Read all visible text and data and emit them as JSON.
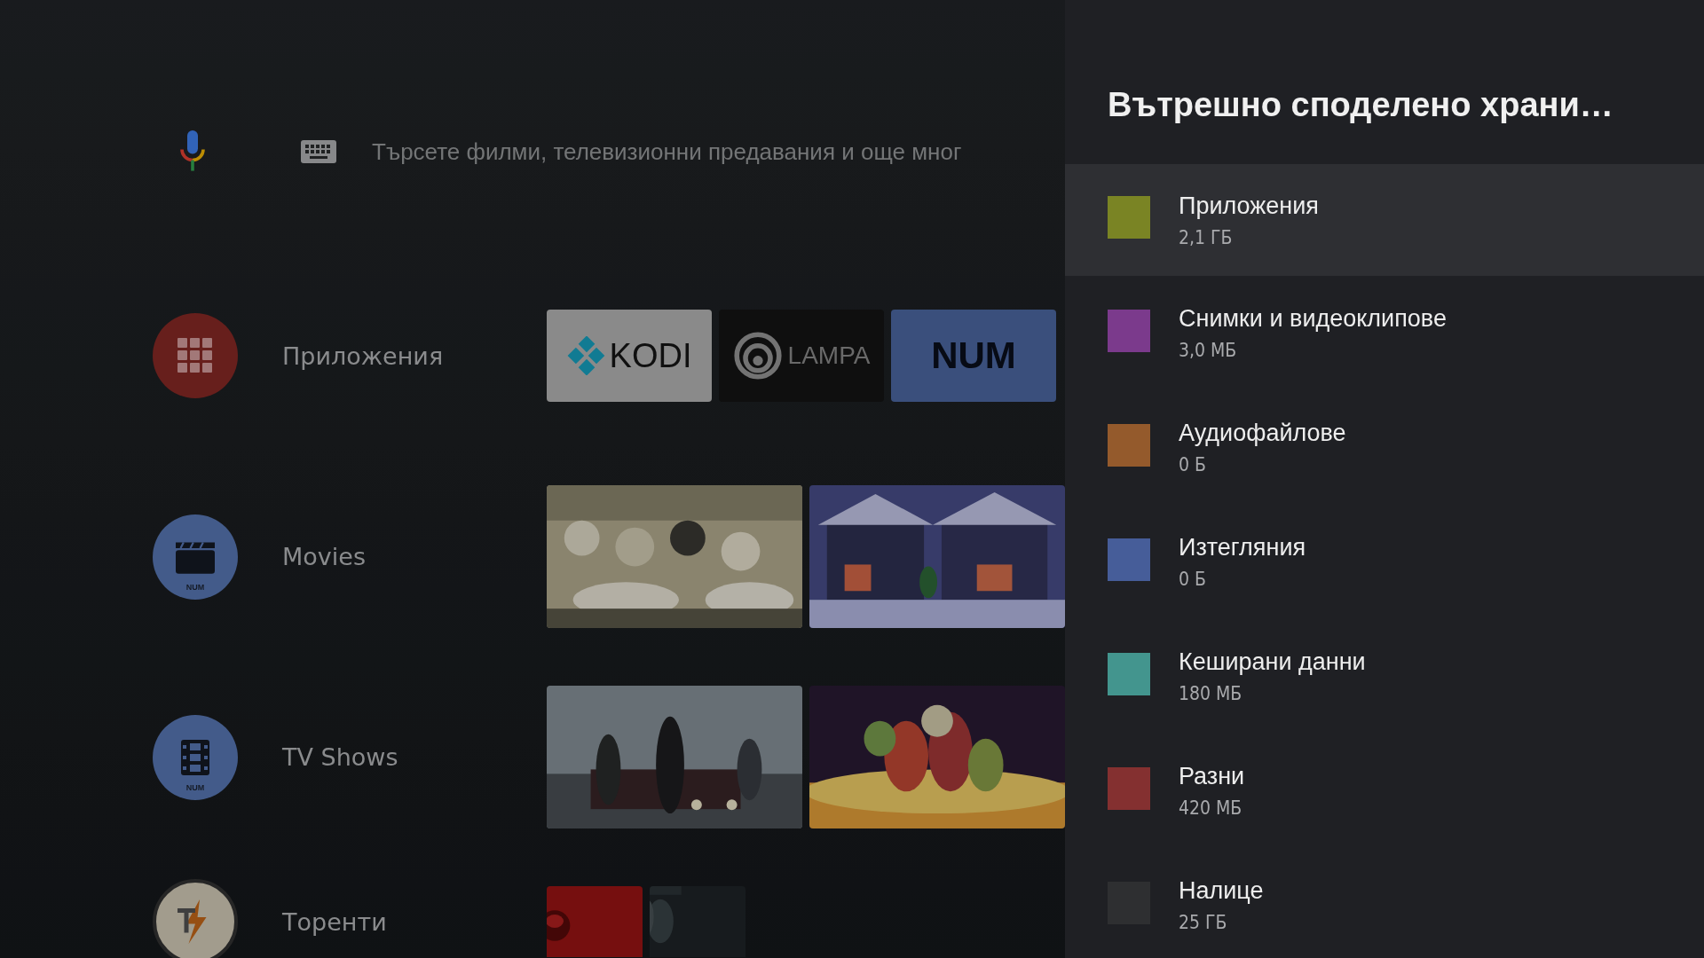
{
  "search": {
    "placeholder": "Търсете филми, телевизионни предавания и още мног"
  },
  "rows": [
    {
      "kind": "apps",
      "label": "Приложения",
      "tiles": [
        {
          "kind": "kodi",
          "text": "KODI"
        },
        {
          "kind": "lampa",
          "text": "LAMPA"
        },
        {
          "kind": "num",
          "text": "NUM"
        }
      ]
    },
    {
      "kind": "movies",
      "label": "Movies",
      "badge": "NUM"
    },
    {
      "kind": "tv",
      "label": "TV Shows",
      "badge": "NUM"
    },
    {
      "kind": "torrents",
      "label": "Торенти"
    }
  ],
  "panel": {
    "title": "Вътрешно споделено храни…",
    "items": [
      {
        "name": "Приложения",
        "size": "2,1 ГБ",
        "color": "#7a8424",
        "selected": true
      },
      {
        "name": "Снимки и видеоклипове",
        "size": "3,0 МБ",
        "color": "#7b3a8c",
        "selected": false
      },
      {
        "name": "Аудиофайлове",
        "size": "0 Б",
        "color": "#945a2c",
        "selected": false
      },
      {
        "name": "Изтегляния",
        "size": "0 Б",
        "color": "#465d99",
        "selected": false
      },
      {
        "name": "Кеширани данни",
        "size": "180 МБ",
        "color": "#43958e",
        "selected": false
      },
      {
        "name": "Разни",
        "size": "420 МБ",
        "color": "#843030",
        "selected": false
      },
      {
        "name": "Налице",
        "size": "25 ГБ",
        "color": "#2e2f31",
        "selected": false
      }
    ]
  }
}
